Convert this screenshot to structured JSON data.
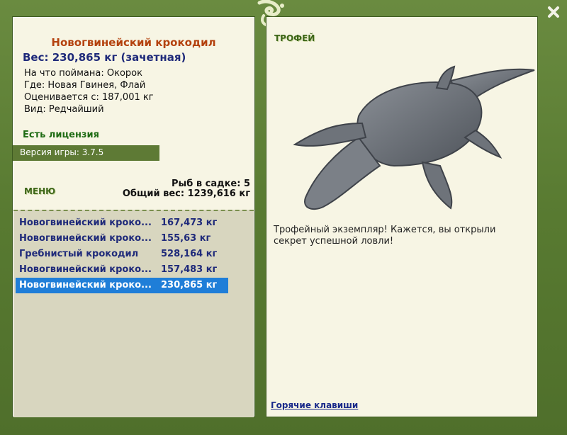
{
  "header": {
    "close_label": "x"
  },
  "fish": {
    "title": "Новогвинейский крокодил",
    "weight": "Вес: 230,865 кг (зачетная)",
    "details": [
      "На что поймана: Окорок",
      "Где: Новая Гвинея, Флай",
      "Оценивается с: 187,001 кг",
      "Вид: Редчайший"
    ]
  },
  "license": "Есть лицензия",
  "version": "Версия игры: 3.7.5",
  "menu_label": "МЕНЮ",
  "cage": {
    "count": "Рыб в садке: 5",
    "total": "Общий вес: 1239,616 кг"
  },
  "catch_list": [
    {
      "name": "Новогвинейский кроко...",
      "weight": "167,473 кг"
    },
    {
      "name": "Новогвинейский кроко...",
      "weight": "155,63 кг"
    },
    {
      "name": "Гребнистый крокодил",
      "weight": "528,164 кг"
    },
    {
      "name": "Новогвинейский кроко...",
      "weight": "157,483 кг"
    },
    {
      "name": "Новогвинейский кроко...",
      "weight": "230,865 кг",
      "selected": true
    }
  ],
  "trophy": {
    "label": "ТРОФЕЙ",
    "text": "Трофейный экземпляр! Кажется, вы открыли секрет успешной ловли!"
  },
  "hotkeys_label": "Горячие клавиши",
  "colors": {
    "frame": "#5d7d35",
    "panel": "#f7f5e4",
    "selected_row": "#1f7ed8"
  }
}
